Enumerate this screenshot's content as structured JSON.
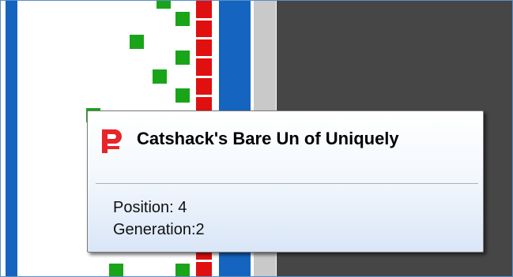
{
  "tooltip": {
    "icon": "brand-logo-icon",
    "title": "Catshack's Bare Un of Uniquely",
    "position_text": "Position: 4",
    "generation_text": "Generation:2"
  },
  "colors": {
    "grid_green": "#1aa41a",
    "track_red": "#e01010",
    "track_blue": "#1565c0",
    "panel_dark": "#464646",
    "logo_red": "#e8242a"
  }
}
